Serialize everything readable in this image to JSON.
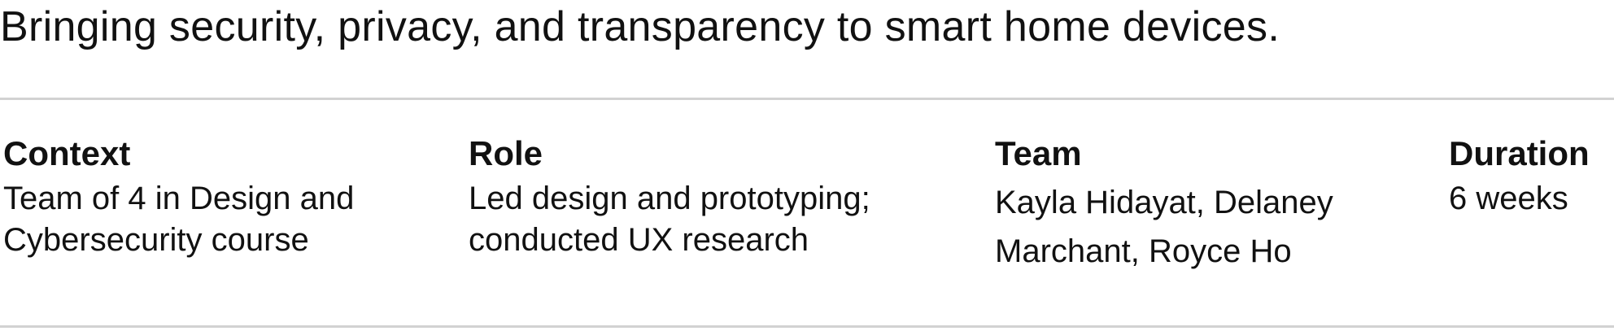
{
  "tagline": "Bringing security, privacy, and transparency to smart home devices.",
  "details": {
    "context": {
      "title": "Context",
      "lines": [
        "Team of 4 in Design and",
        "Cybersecurity course"
      ]
    },
    "role": {
      "title": "Role",
      "lines": [
        "Led design and prototyping;",
        "conducted UX research"
      ]
    },
    "team": {
      "title": "Team",
      "lines": [
        "Kayla Hidayat, Delaney",
        "Marchant, Royce Ho"
      ]
    },
    "duration": {
      "title": "Duration",
      "lines": [
        "6 weeks"
      ]
    }
  },
  "colors": {
    "text": "#111111",
    "divider": "#d2d2d2",
    "background": "#ffffff"
  }
}
